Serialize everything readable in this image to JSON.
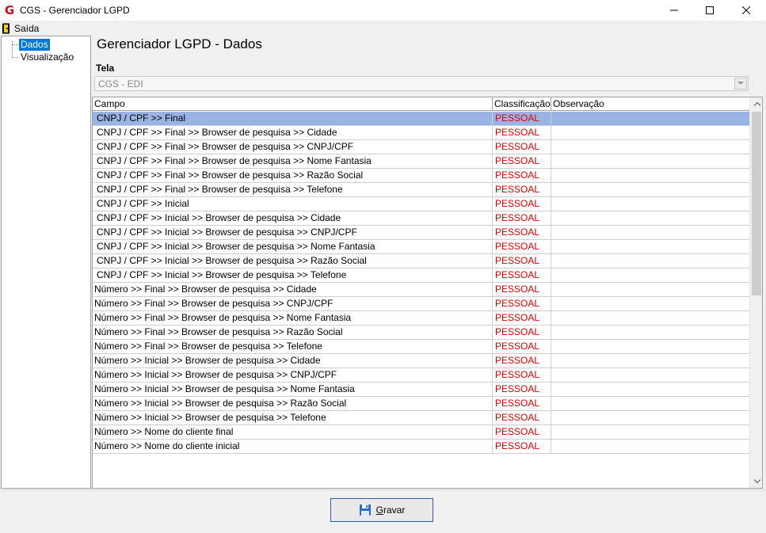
{
  "window": {
    "title": "CGS - Gerenciador LGPD",
    "app_icon_glyph": "G",
    "brand_color": "#c1121f"
  },
  "menu": {
    "exit_label": "Saída"
  },
  "sidebar": {
    "items": [
      {
        "label": "Dados",
        "selected": true
      },
      {
        "label": "Visualização",
        "selected": false
      }
    ]
  },
  "main": {
    "title": "Gerenciador LGPD - Dados",
    "tela_label": "Tela",
    "tela_value": "CGS - EDI"
  },
  "grid": {
    "columns": [
      "Campo",
      "Classificação",
      "Observação"
    ],
    "classification_color": "#e00000",
    "selected_row_color": "#99b4e4",
    "rows": [
      {
        "campo": "CNPJ / CPF >> Final",
        "classificacao": "PESSOAL",
        "observacao": ""
      },
      {
        "campo": "CNPJ / CPF >> Final >> Browser de pesquisa >> Cidade",
        "classificacao": "PESSOAL",
        "observacao": ""
      },
      {
        "campo": "CNPJ / CPF >> Final >> Browser de pesquisa >> CNPJ/CPF",
        "classificacao": "PESSOAL",
        "observacao": ""
      },
      {
        "campo": "CNPJ / CPF >> Final >> Browser de pesquisa >> Nome Fantasia",
        "classificacao": "PESSOAL",
        "observacao": ""
      },
      {
        "campo": "CNPJ / CPF >> Final >> Browser de pesquisa >> Razão Social",
        "classificacao": "PESSOAL",
        "observacao": ""
      },
      {
        "campo": "CNPJ / CPF >> Final >> Browser de pesquisa >> Telefone",
        "classificacao": "PESSOAL",
        "observacao": ""
      },
      {
        "campo": "CNPJ / CPF >> Inicial",
        "classificacao": "PESSOAL",
        "observacao": ""
      },
      {
        "campo": "CNPJ / CPF >> Inicial >> Browser de pesquisa >> Cidade",
        "classificacao": "PESSOAL",
        "observacao": ""
      },
      {
        "campo": "CNPJ / CPF >> Inicial >> Browser de pesquisa >> CNPJ/CPF",
        "classificacao": "PESSOAL",
        "observacao": ""
      },
      {
        "campo": "CNPJ / CPF >> Inicial >> Browser de pesquisa >> Nome Fantasia",
        "classificacao": "PESSOAL",
        "observacao": ""
      },
      {
        "campo": "CNPJ / CPF >> Inicial >> Browser de pesquisa >> Razão Social",
        "classificacao": "PESSOAL",
        "observacao": ""
      },
      {
        "campo": "CNPJ / CPF >> Inicial >> Browser de pesquisa >> Telefone",
        "classificacao": "PESSOAL",
        "observacao": ""
      },
      {
        "campo": "Número >> Final >> Browser de pesquisa >> Cidade",
        "classificacao": "PESSOAL",
        "observacao": ""
      },
      {
        "campo": "Número >> Final >> Browser de pesquisa >> CNPJ/CPF",
        "classificacao": "PESSOAL",
        "observacao": ""
      },
      {
        "campo": "Número >> Final >> Browser de pesquisa >> Nome Fantasia",
        "classificacao": "PESSOAL",
        "observacao": ""
      },
      {
        "campo": "Número >> Final >> Browser de pesquisa >> Razão Social",
        "classificacao": "PESSOAL",
        "observacao": ""
      },
      {
        "campo": "Número >> Final >> Browser de pesquisa >> Telefone",
        "classificacao": "PESSOAL",
        "observacao": ""
      },
      {
        "campo": "Número >> Inicial >> Browser de pesquisa >> Cidade",
        "classificacao": "PESSOAL",
        "observacao": ""
      },
      {
        "campo": "Número >> Inicial >> Browser de pesquisa >> CNPJ/CPF",
        "classificacao": "PESSOAL",
        "observacao": ""
      },
      {
        "campo": "Número >> Inicial >> Browser de pesquisa >> Nome Fantasia",
        "classificacao": "PESSOAL",
        "observacao": ""
      },
      {
        "campo": "Número >> Inicial >> Browser de pesquisa >> Razão Social",
        "classificacao": "PESSOAL",
        "observacao": ""
      },
      {
        "campo": "Número >> Inicial >> Browser de pesquisa >> Telefone",
        "classificacao": "PESSOAL",
        "observacao": ""
      },
      {
        "campo": "Número >> Nome do cliente final",
        "classificacao": "PESSOAL",
        "observacao": ""
      },
      {
        "campo": "Número >> Nome do cliente inicial",
        "classificacao": "PESSOAL",
        "observacao": ""
      }
    ]
  },
  "footer": {
    "save_label_underlined": "G",
    "save_label_rest": "ravar"
  }
}
